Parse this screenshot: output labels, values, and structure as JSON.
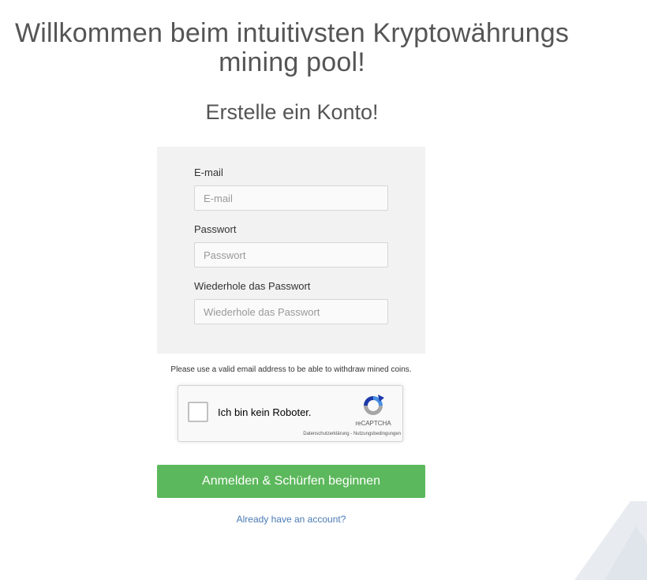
{
  "header": {
    "headline": "Willkommen beim intuitivsten Kryptowährungs mining pool!",
    "subheadline": "Erstelle ein Konto!"
  },
  "form": {
    "email": {
      "label": "E-mail",
      "placeholder": "E-mail",
      "value": ""
    },
    "password": {
      "label": "Passwort",
      "placeholder": "Passwort",
      "value": ""
    },
    "password_repeat": {
      "label": "Wiederhole das Passwort",
      "placeholder": "Wiederhole das Passwort",
      "value": ""
    }
  },
  "notice": "Please use a valid email address to be able to withdraw mined coins.",
  "captcha": {
    "label": "Ich bin kein Roboter.",
    "brand": "reCAPTCHA",
    "links": "Datenschutzerklärung - Nutzungsbedingungen",
    "checked": false,
    "icon": "recaptcha-logo-icon"
  },
  "submit_label": "Anmelden & Schürfen beginnen",
  "login_link": "Already have an account?",
  "colors": {
    "accent": "#5cb85c",
    "link": "#4a7ab5",
    "panel": "#f2f2f2",
    "background_shape": "#e6ebf0"
  }
}
